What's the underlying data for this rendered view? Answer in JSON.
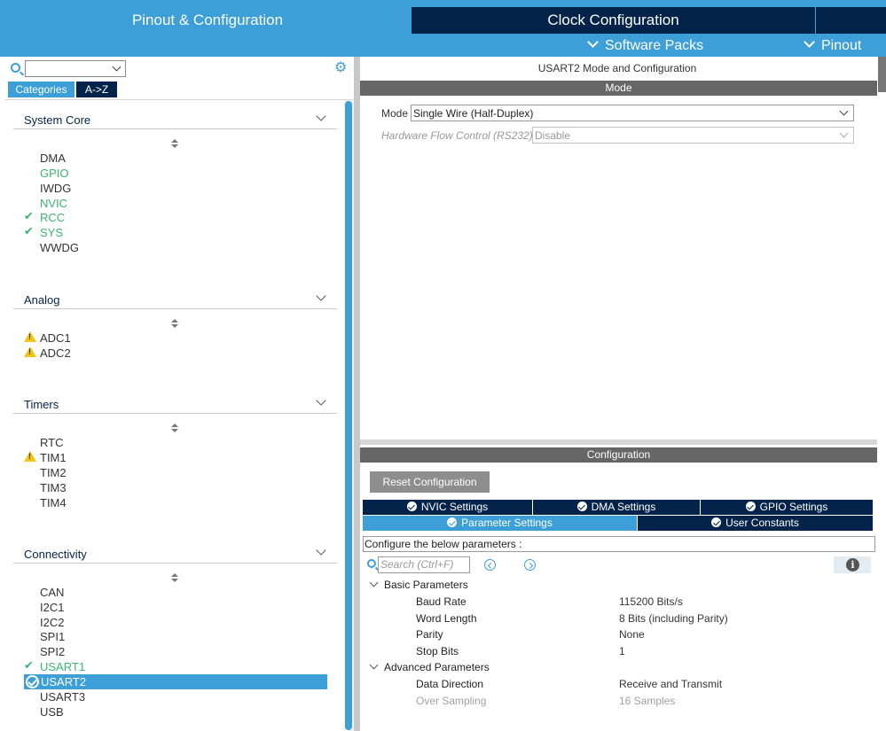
{
  "header": {
    "tab_pinout": "Pinout & Configuration",
    "tab_clock": "Clock Configuration",
    "menu_software_packs": "Software Packs",
    "menu_pinout": "Pinout"
  },
  "left": {
    "search_value": "",
    "tab_categories": "Categories",
    "tab_az": "A->Z",
    "sections": {
      "system_core": {
        "title": "System Core",
        "items": [
          "DMA",
          "GPIO",
          "IWDG",
          "NVIC",
          "RCC",
          "SYS",
          "WWDG"
        ]
      },
      "analog": {
        "title": "Analog",
        "items": [
          "ADC1",
          "ADC2"
        ]
      },
      "timers": {
        "title": "Timers",
        "items": [
          "RTC",
          "TIM1",
          "TIM2",
          "TIM3",
          "TIM4"
        ]
      },
      "connectivity": {
        "title": "Connectivity",
        "items": [
          "CAN",
          "I2C1",
          "I2C2",
          "SPI1",
          "SPI2",
          "USART1",
          "USART2",
          "USART3",
          "USB"
        ]
      }
    }
  },
  "right": {
    "title": "USART2 Mode and Configuration",
    "mode_bar": "Mode",
    "mode_label": "Mode",
    "mode_value": "Single Wire (Half-Duplex)",
    "hw_label": "Hardware Flow Control (RS232)",
    "hw_value": "Disable",
    "config_bar": "Configuration",
    "reset_button": "Reset Configuration",
    "tabs": {
      "nvic": "NVIC Settings",
      "dma": "DMA Settings",
      "gpio": "GPIO Settings",
      "param": "Parameter Settings",
      "user": "User Constants"
    },
    "configure_text": "Configure the below parameters :",
    "search_placeholder": "Search (Ctrl+F)",
    "basic": {
      "title": "Basic Parameters",
      "params": [
        {
          "name": "Baud Rate",
          "value": "115200 Bits/s"
        },
        {
          "name": "Word Length",
          "value": "8 Bits (including Parity)"
        },
        {
          "name": "Parity",
          "value": "None"
        },
        {
          "name": "Stop Bits",
          "value": "1"
        }
      ]
    },
    "advanced": {
      "title": "Advanced Parameters",
      "params": [
        {
          "name": "Data Direction",
          "value": "Receive and Transmit"
        },
        {
          "name": "Over Sampling",
          "value": "16 Samples"
        }
      ]
    }
  },
  "colors": {
    "accent": "#3c9fd8",
    "navy": "#03234b",
    "enabled_green": "#3cb371",
    "warning_yellow": "#f2c417",
    "bar_gray": "#666666"
  }
}
